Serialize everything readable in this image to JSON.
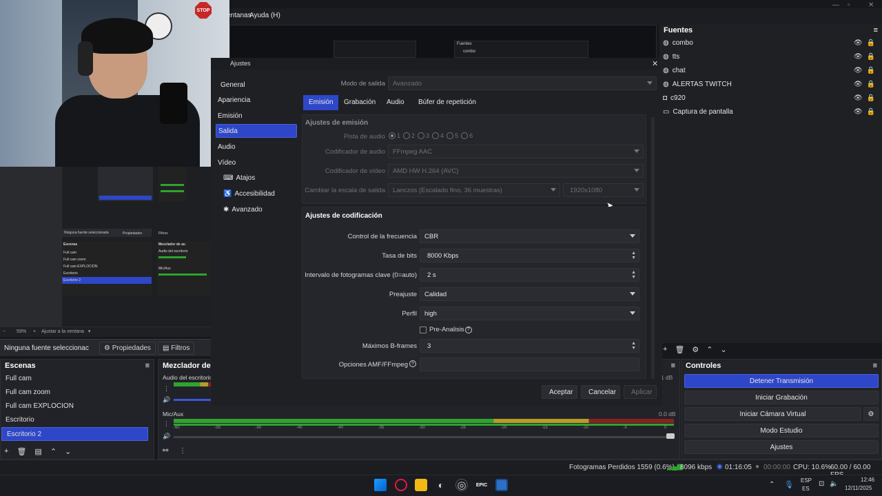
{
  "menu": {
    "ventanas": "entanas",
    "ayuda": "Ayuda (H)"
  },
  "preview": {
    "fuentes_label": "Fuentes",
    "combo_label": "combo"
  },
  "webcam": {
    "stop_text": "STOP"
  },
  "mini_obs": {
    "zoom": "59%",
    "fit": "Ajustar a la ventana",
    "no_source": "Ninguna fuente seleccionada",
    "properties": "Propiedades",
    "filters": "Filtros",
    "scenes_title": "Escenas",
    "mixer_title": "Mezclador de au",
    "scenes": [
      "Full cam",
      "Full cam zoom",
      "Full cam EXPLOCION",
      "Escritorio",
      "Escritorio 2"
    ],
    "desktop_audio": "Audio del escritorio",
    "mic": "Mic/Aux"
  },
  "source_bar": {
    "no_source": "Ninguna fuente seleccionac",
    "properties": "Propiedades",
    "filters": "Filtros"
  },
  "scenes": {
    "title": "Escenas",
    "items": [
      "Full cam",
      "Full cam zoom",
      "Full cam EXPLOCION",
      "Escritorio",
      "Escritorio 2"
    ],
    "selected_index": 4
  },
  "mixer": {
    "title": "Mezclador de au",
    "desktop_label": "Audio del escritorio",
    "desktop_db": "-1 dB",
    "mic_label": "Mic/Aux",
    "mic_db": "0.0 dB",
    "scale": [
      "-60",
      "-55",
      "-50",
      "-45",
      "-40",
      "-35",
      "-30",
      "-25",
      "-20",
      "-15",
      "-10",
      "-5",
      "0"
    ],
    "mic_level": 0.85
  },
  "dialog": {
    "title": "Ajustes",
    "nav": [
      "General",
      "Apariencia",
      "Emisión",
      "Salida",
      "Audio",
      "Vídeo",
      "Atajos",
      "Accesibilidad",
      "Avanzado"
    ],
    "nav_selected": 3,
    "output_mode_label": "Modo de salida",
    "output_mode_value": "Avanzado",
    "tabs": [
      "Emisión",
      "Grabación",
      "Audio",
      "Búfer de repetición"
    ],
    "tab_selected": 0,
    "emission_group": "Ajustes de emisión",
    "audio_track_label": "Pista de audio",
    "audio_tracks": [
      "1",
      "2",
      "3",
      "4",
      "5",
      "6"
    ],
    "audio_encoder_label": "Codificador de audio",
    "audio_encoder_value": "FFmpeg AAC",
    "video_encoder_label": "Codificador de vídeo",
    "video_encoder_value": "AMD HW H.264 (AVC)",
    "rescale_label": "Cambiar la escala de salida",
    "rescale_value": "Lanczos (Escalado fino, 36 muestras)",
    "rescale_res": "1920x1080",
    "coding_group": "Ajustes de codificación",
    "rate_control_label": "Control de la frecuencia",
    "rate_control_value": "CBR",
    "bitrate_label": "Tasa de bits",
    "bitrate_value": "8000 Kbps",
    "keyframe_label": "Intervalo de fotogramas clave (0=auto)",
    "keyframe_value": "2 s",
    "preset_label": "Preajuste",
    "preset_value": "Calidad",
    "profile_label": "Perfil",
    "profile_value": "high",
    "preanalysis_label": "Pre-Analisis",
    "bframes_label": "Máximos B-frames",
    "bframes_value": "3",
    "amf_label": "Opciones AMF/FFmpeg",
    "amf_value": "",
    "accept": "Aceptar",
    "cancel": "Cancelar",
    "apply": "Aplicar"
  },
  "sources": {
    "title": "Fuentes",
    "items": [
      {
        "name": "combo",
        "icon": "globe-icon"
      },
      {
        "name": "tts",
        "icon": "globe-icon"
      },
      {
        "name": "chat",
        "icon": "globe-icon"
      },
      {
        "name": "ALERTAS TWITCH",
        "icon": "globe-icon"
      },
      {
        "name": "c920",
        "icon": "camera-icon"
      },
      {
        "name": "Captura de pantalla",
        "icon": "monitor-icon"
      }
    ]
  },
  "controls": {
    "title": "Controles",
    "stop_stream": "Detener Transmisión",
    "start_recording": "Iniciar Grabación",
    "virtual_cam": "Iniciar Cámara Virtual",
    "studio_mode": "Modo Estudio",
    "settings": "Ajustes"
  },
  "status": {
    "dropped": "Fotogramas Perdidos 1559 (0.6%)",
    "kbps": "8096 kbps",
    "stream_time": "01:16:05",
    "rec_time": "00:00:00",
    "cpu": "CPU: 10.6%",
    "fps": "60.00 / 60.00 FPS"
  },
  "taskbar": {
    "lang1": "ESP",
    "lang2": "ES",
    "time": "12:46",
    "date": "12/11/2025"
  }
}
